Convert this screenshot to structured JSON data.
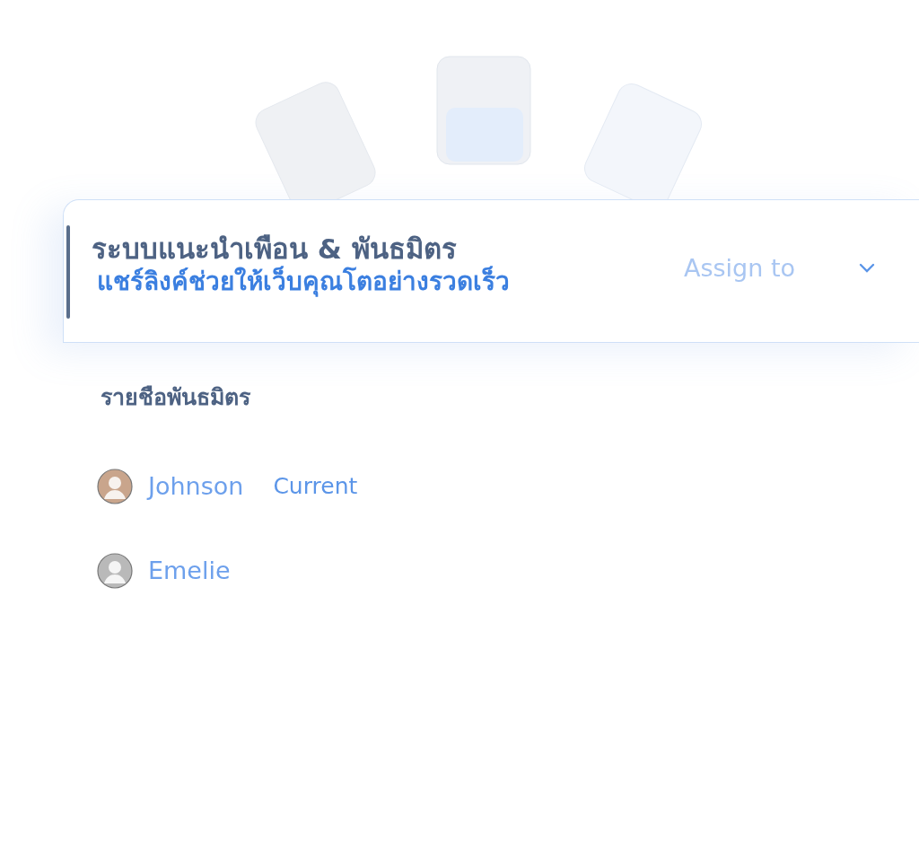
{
  "header": {
    "title": "ระบบแนะนำเพือน & พันธมิตร",
    "subtitle": "แชร์ลิงค์ช่วยให้เว็บคุณโตอย่างรวดเร็ว",
    "assign": {
      "label": "Assign to",
      "expanded": false
    }
  },
  "list": {
    "title": "รายชือพันธมิตร",
    "members": [
      {
        "name": "Johnson",
        "tag": "Current",
        "color": "#c9a58c"
      },
      {
        "name": "Emelie",
        "color": "#b9b9b9"
      }
    ]
  }
}
